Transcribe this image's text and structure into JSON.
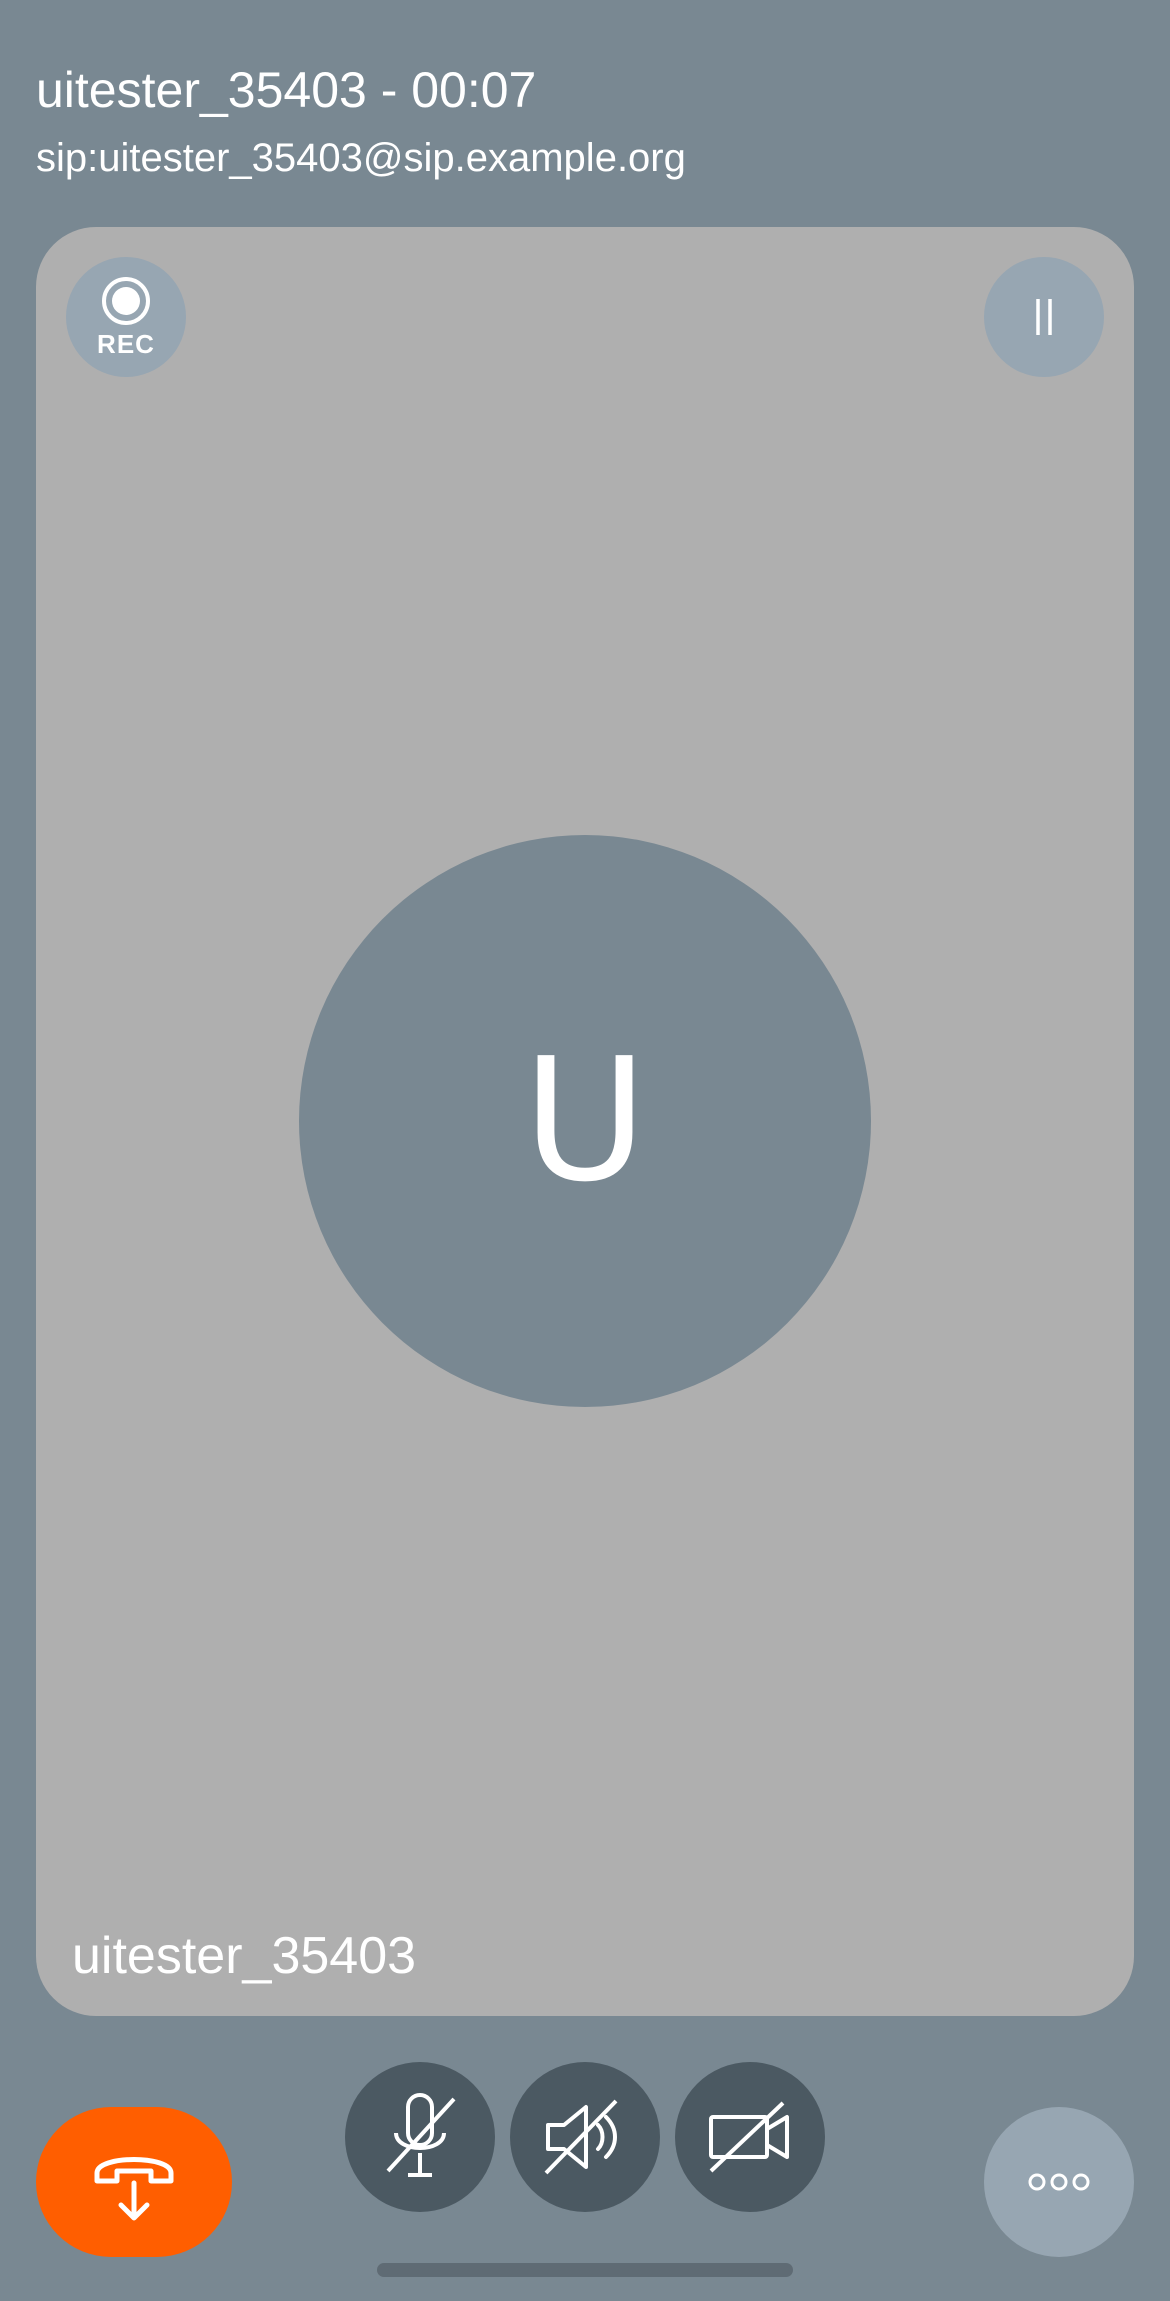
{
  "call": {
    "title": "uitester_35403 - 00:07",
    "address": "sip:uitester_35403@sip.example.org"
  },
  "video": {
    "record_label": "REC",
    "avatar_initial": "U",
    "participant_name": "uitester_35403"
  },
  "controls": {
    "hangup_icon": "hangup-phone-icon",
    "mic_icon": "mic-off-icon",
    "speaker_icon": "speaker-off-icon",
    "camera_icon": "camera-off-icon",
    "more_icon": "more-options-icon"
  },
  "colors": {
    "background": "#798892",
    "card": "#afafaf",
    "hangup": "#ff5e00",
    "control": "#4b5962",
    "secondary_button": "#97a6b2"
  }
}
